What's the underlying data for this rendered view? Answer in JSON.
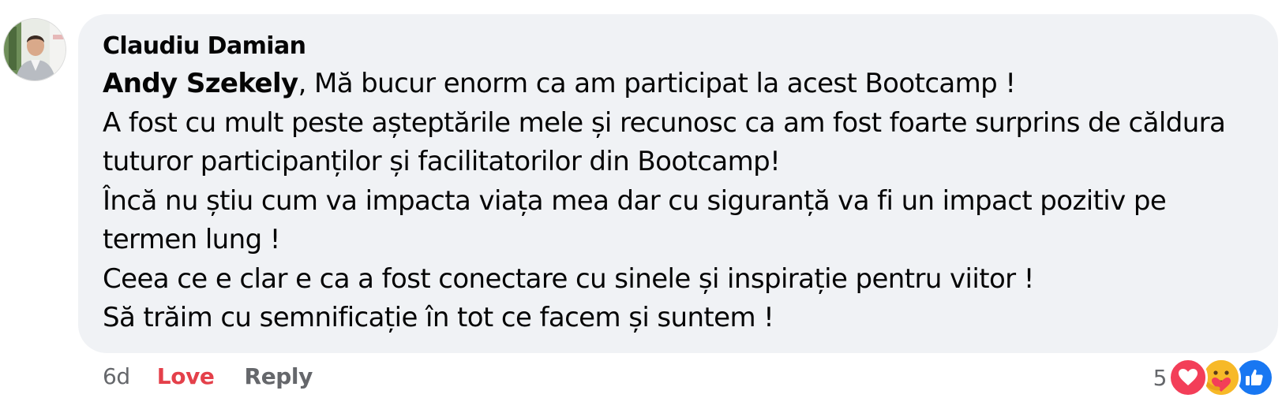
{
  "comment": {
    "author": "Claudiu Damian",
    "mention": "Andy Szekely",
    "first_line_rest": ", Mă bucur enorm ca am participat la acest Bootcamp !",
    "lines": [
      "A fost cu mult peste așteptările mele și recunosc ca am fost foarte surprins de căldura",
      "tuturor participanților și facilitatorilor din Bootcamp!",
      "Încă nu știu cum va impacta viața mea dar cu siguranță va fi un impact pozitiv pe",
      "termen lung !",
      "Ceea ce e clar e ca a fost conectare cu sinele și inspirație pentru viitor !",
      "Să trăim cu semnificație în tot ce facem și suntem !"
    ]
  },
  "actions": {
    "time": "6d",
    "love_label": "Love",
    "reply_label": "Reply"
  },
  "reactions": {
    "count": "5",
    "icons": [
      "love-icon",
      "care-icon",
      "like-icon"
    ]
  },
  "colors": {
    "bubble": "#f0f2f5",
    "love": "#e4404a",
    "muted": "#65676b",
    "like": "#1877f2"
  }
}
